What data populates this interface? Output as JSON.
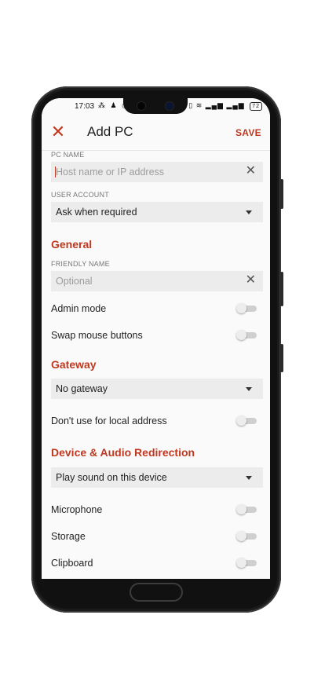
{
  "status_bar": {
    "time": "17:03",
    "left_icons": "⁂ ♟ ◎",
    "right_icons": "▯ ≋ ▂▄▆ ▂▄▆",
    "battery": "72"
  },
  "appbar": {
    "title": "Add PC",
    "save_label": "SAVE",
    "close_glyph": "✕"
  },
  "pc_name": {
    "label": "PC NAME",
    "placeholder": "Host name or IP address",
    "clear_glyph": "✕"
  },
  "user_account": {
    "label": "USER ACCOUNT",
    "value": "Ask when required"
  },
  "general": {
    "title": "General",
    "friendly_name_label": "FRIENDLY NAME",
    "friendly_name_placeholder": "Optional",
    "clear_glyph": "✕",
    "admin_mode": {
      "label": "Admin mode",
      "on": false
    },
    "swap_mouse": {
      "label": "Swap mouse buttons",
      "on": false
    }
  },
  "gateway": {
    "title": "Gateway",
    "value": "No gateway",
    "local_address": {
      "label": "Don't use for local address",
      "on": false
    }
  },
  "device_audio": {
    "title": "Device & Audio Redirection",
    "sound_value": "Play sound on this device",
    "microphone": {
      "label": "Microphone",
      "on": false
    },
    "storage": {
      "label": "Storage",
      "on": false
    },
    "clipboard": {
      "label": "Clipboard",
      "on": false
    }
  },
  "colors": {
    "accent": "#c0381f",
    "background": "#fafafa",
    "field": "#ececec"
  }
}
